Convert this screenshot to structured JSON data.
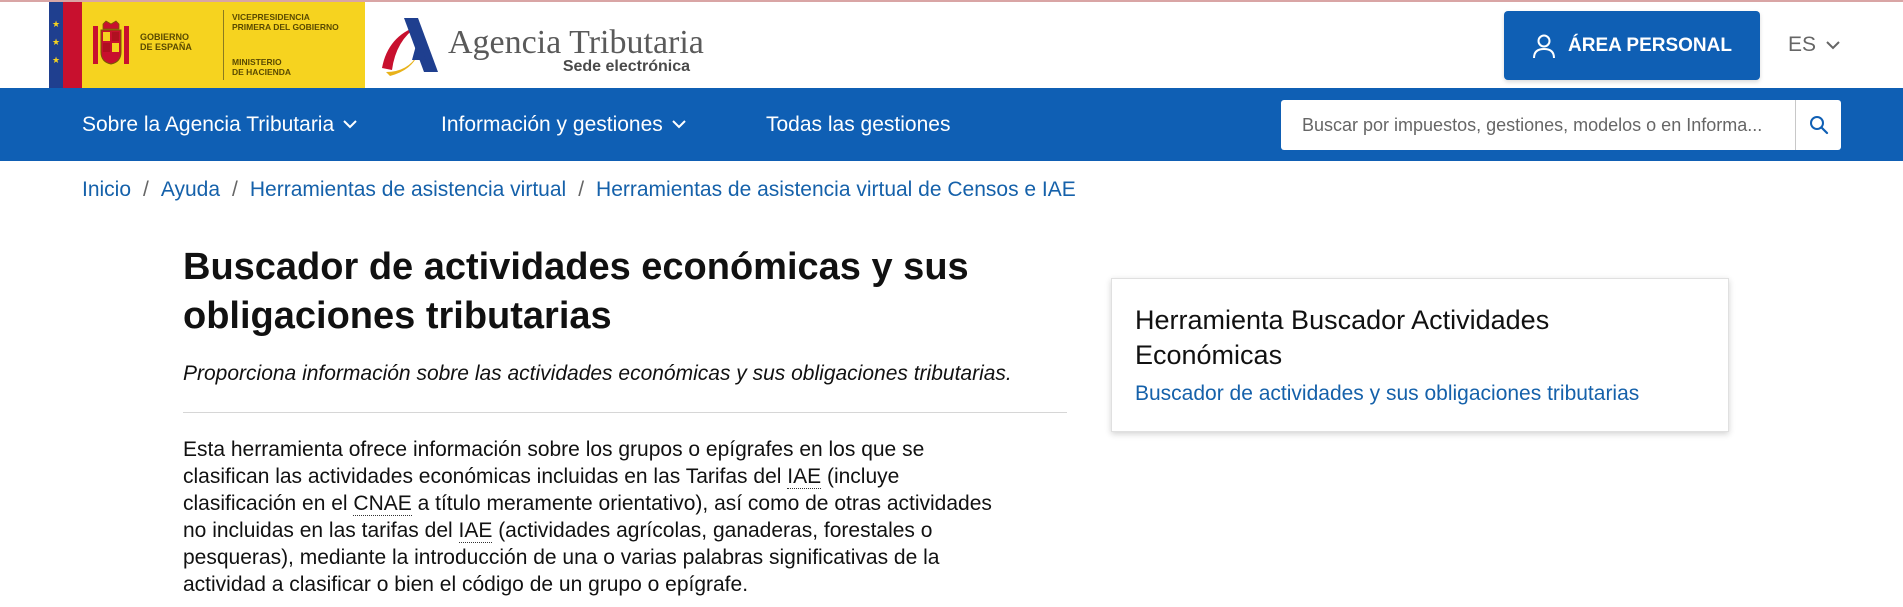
{
  "colors": {
    "brand_blue": "#0f5fb4",
    "link_blue": "#1561aa",
    "gov_yellow": "#f6d31f"
  },
  "gov_logo": {
    "line1": "GOBIERNO",
    "line2": "DE ESPAÑA",
    "vice_1": "VICEPRESIDENCIA",
    "vice_2": "PRIMERA DEL GOBIERNO",
    "min_1": "MINISTERIO",
    "min_2": "DE HACIENDA"
  },
  "agency_logo": {
    "title": "Agencia Tributaria",
    "subtitle": "Sede electrónica"
  },
  "header": {
    "area_personal_label": "ÁREA PERSONAL",
    "language": "ES",
    "user_icon": "user-icon",
    "chevron_icon": "chevron-down-icon"
  },
  "nav": {
    "items": [
      {
        "label": "Sobre la Agencia Tributaria",
        "has_dropdown": true
      },
      {
        "label": "Información y gestiones",
        "has_dropdown": true
      },
      {
        "label": "Todas las gestiones",
        "has_dropdown": false
      }
    ],
    "search": {
      "placeholder": "Buscar por impuestos, gestiones, modelos o en Informa...",
      "value": "",
      "icon": "search-icon"
    }
  },
  "breadcrumb": [
    {
      "label": "Inicio"
    },
    {
      "label": "Ayuda"
    },
    {
      "label": "Herramientas de asistencia virtual"
    },
    {
      "label": "Herramientas de asistencia virtual de Censos e IAE"
    }
  ],
  "breadcrumb_separator": "/",
  "main": {
    "title_line1": "Buscador de actividades económicas y sus",
    "title_line2": "obligaciones tributarias",
    "subtitle": "Proporciona información sobre las actividades económicas y sus obligaciones tributarias.",
    "body": {
      "l1": "Esta herramienta ofrece información sobre los grupos o epígrafes en los que se",
      "l2a": "clasifican las actividades económicas incluidas en las Tarifas del ",
      "abbr_iae": "IAE",
      "l2b": " (incluye",
      "l3a": "clasificación en el ",
      "abbr_cnae": "CNAE",
      "l3b": "  a título meramente orientativo), así como de otras actividades",
      "l4a": "no incluidas en las tarifas del  ",
      "l4b": " (actividades agrícolas, ganaderas, forestales o",
      "l5": "pesqueras), mediante la introducción de una o varias palabras significativas de la",
      "l6": "actividad a clasificar o bien el código de un grupo o epígrafe."
    }
  },
  "side_card": {
    "title_line1": "Herramienta Buscador Actividades",
    "title_line2": "Económicas",
    "link": "Buscador de actividades y sus obligaciones tributarias"
  }
}
